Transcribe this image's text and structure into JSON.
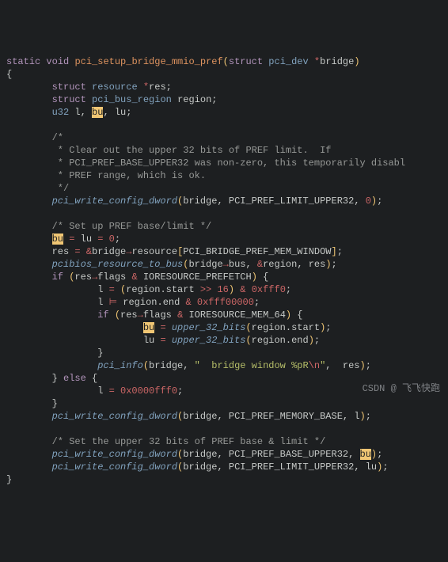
{
  "lines": {
    "l00": {
      "kw1": "static",
      "kw2": "void",
      "fn": "pci_setup_bridge_mmio_pref",
      "p1": "(",
      "kw3": "struct",
      "t1": "pci_dev",
      "op": "*",
      "arg": "bridge",
      "p2": ")"
    },
    "l01": {
      "brace": "{"
    },
    "l02": {
      "kw": "struct",
      "t": "resource",
      "op": "*",
      "id": "res",
      "semi": ";"
    },
    "l03": {
      "kw": "struct",
      "t": "pci_bus_region",
      "id": "region",
      "semi": ";"
    },
    "l04": {
      "t": "u32",
      "id1": "l",
      "c1": ",",
      "sp": " ",
      "hl": "bu",
      "c2": ",",
      "id2": " lu",
      "semi": ";"
    },
    "l05": {
      "c": "/*"
    },
    "l06": {
      "c": " * Clear out the upper 32 bits of PREF limit.  If"
    },
    "l07": {
      "c": " * PCI_PREF_BASE_UPPER32 was non-zero, this temporarily disabl"
    },
    "l08": {
      "c": " * PREF range, which is ok."
    },
    "l09": {
      "c": " */"
    },
    "l10": {
      "fn": "pci_write_config_dword",
      "p1": "(",
      "a1": "bridge",
      "c1": ", ",
      "m": "PCI_PREF_LIMIT_UPPER32",
      "c2": ", ",
      "n": "0",
      "p2": ")",
      "semi": ";"
    },
    "l11": {
      "c": "/* Set up PREF base/limit */"
    },
    "l12": {
      "hl": "bu",
      "sp": " ",
      "eq": "=",
      "id": " lu ",
      "eq2": "=",
      "sp2": " ",
      "n": "0",
      "semi": ";"
    },
    "l13": {
      "id1": "res ",
      "eq": "=",
      "sp": " ",
      "amp": "&",
      "id2": "bridge",
      "arw": "→",
      "id3": "resource",
      "p1": "[",
      "m": "PCI_BRIDGE_PREF_MEM_WINDOW",
      "p2": "]",
      "semi": ";"
    },
    "l14": {
      "fn": "pcibios_resource_to_bus",
      "p1": "(",
      "a1": "bridge",
      "arw": "→",
      "a1b": "bus",
      "c1": ", ",
      "amp": "&",
      "a2": "region",
      "c2": ", ",
      "a3": "res",
      "p2": ")",
      "semi": ";"
    },
    "l15": {
      "kw": "if",
      "sp": " ",
      "p1": "(",
      "id1": "res",
      "arw": "→",
      "id2": "flags ",
      "amp": "&",
      "sp2": " ",
      "m": "IORESOURCE_PREFETCH",
      "p2": ")",
      "sp3": " ",
      "brace": "{"
    },
    "l16": {
      "id1": "l ",
      "eq": "=",
      "sp": " ",
      "p1": "(",
      "id2": "region.start ",
      "sh": ">>",
      "sp2": " ",
      "n1": "16",
      "p2": ")",
      "sp3": " ",
      "amp": "&",
      "sp4": " ",
      "n2": "0xfff0",
      "semi": ";"
    },
    "l17": {
      "id": "l ",
      "op": "⊨",
      "sp": " region.end ",
      "amp": "&",
      "sp2": " ",
      "n": "0xfff00000",
      "semi": ";"
    },
    "l18": {
      "kw": "if",
      "sp": " ",
      "p1": "(",
      "id1": "res",
      "arw": "→",
      "id2": "flags ",
      "amp": "&",
      "sp2": " ",
      "m": "IORESOURCE_MEM_64",
      "p2": ")",
      "sp3": " ",
      "brace": "{"
    },
    "l19": {
      "hl": "bu",
      "sp": " ",
      "eq": "=",
      "sp2": " ",
      "fn": "upper_32_bits",
      "p1": "(",
      "a": "region.start",
      "p2": ")",
      "semi": ";"
    },
    "l20": {
      "id": "lu ",
      "eq": "=",
      "sp": " ",
      "fn": "upper_32_bits",
      "p1": "(",
      "a": "region.end",
      "p2": ")",
      "semi": ";"
    },
    "l21": {
      "brace": "}"
    },
    "l22": {
      "fn": "pci_info",
      "p1": "(",
      "a1": "bridge",
      "c1": ", ",
      "q1": "\"",
      "s": "  bridge window %pR",
      "esc": "\\n",
      "q2": "\"",
      "c2": ", ",
      "a2": " res",
      "p2": ")",
      "semi": ";"
    },
    "l23": {
      "brace1": "}",
      "sp": " ",
      "kw": "else",
      "sp2": " ",
      "brace2": "{"
    },
    "l24": {
      "id": "l ",
      "eq": "=",
      "sp": " ",
      "n": "0x0000fff0",
      "semi": ";"
    },
    "l25": {
      "brace": "}"
    },
    "l26": {
      "fn": "pci_write_config_dword",
      "p1": "(",
      "a1": "bridge",
      "c1": ", ",
      "m": "PCI_PREF_MEMORY_BASE",
      "c2": ", ",
      "a2": "l",
      "p2": ")",
      "semi": ";"
    },
    "l27": {
      "c": "/* Set the upper 32 bits of PREF base & limit */"
    },
    "l28": {
      "fn": "pci_write_config_dword",
      "p1": "(",
      "a1": "bridge",
      "c1": ", ",
      "m": "PCI_PREF_BASE_UPPER32",
      "c2": ", ",
      "hl": "bu",
      "p2": ")",
      "semi": ";"
    },
    "l29": {
      "fn": "pci_write_config_dword",
      "p1": "(",
      "a1": "bridge",
      "c1": ", ",
      "m": "PCI_PREF_LIMIT_UPPER32",
      "c2": ", lu",
      "p2": ")",
      "semi": ";"
    },
    "l30": {
      "brace": "}"
    }
  },
  "watermark": "CSDN @ 飞飞快跑"
}
